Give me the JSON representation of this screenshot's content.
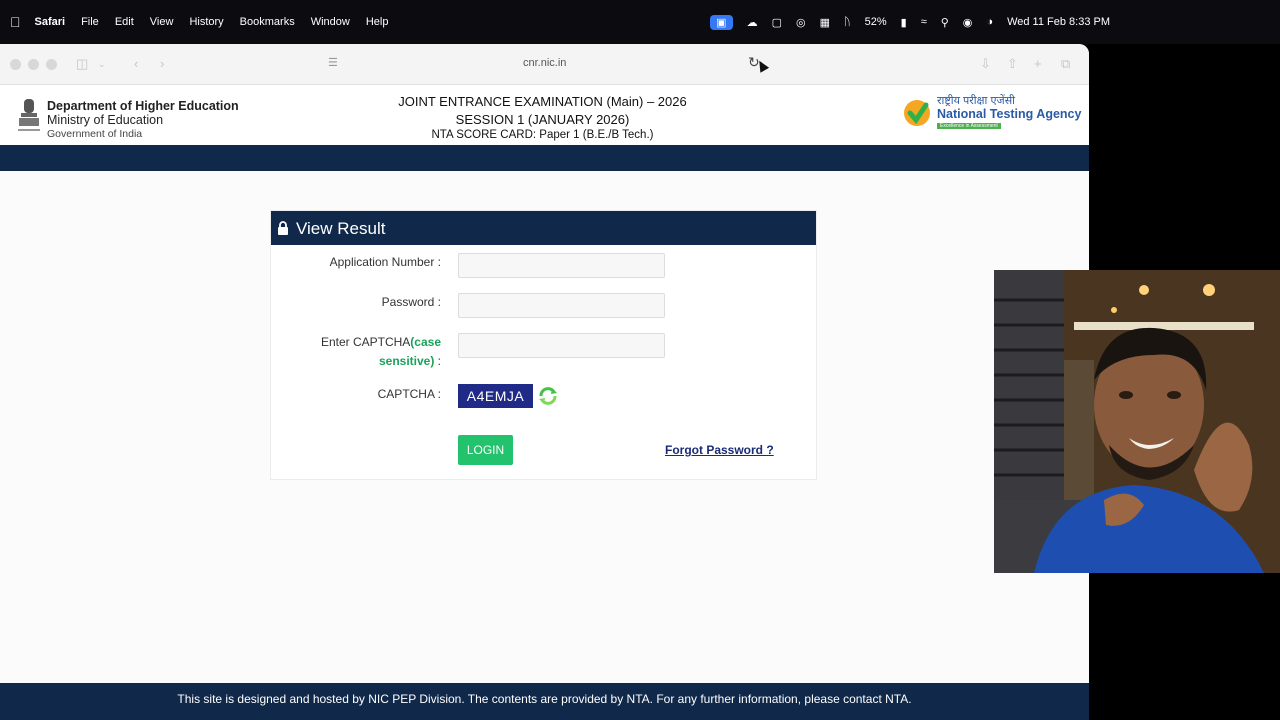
{
  "menubar": {
    "app": "Safari",
    "menus": [
      "File",
      "Edit",
      "View",
      "History",
      "Bookmarks",
      "Window",
      "Help"
    ],
    "battery": "52%",
    "datetime": "Wed 11 Feb  8:33 PM"
  },
  "browser": {
    "url": "cnr.nic.in"
  },
  "header": {
    "dept_line1": "Department of Higher Education",
    "dept_line2": "Ministry of Education",
    "dept_line3": "Government of India",
    "exam_line1": "JOINT ENTRANCE EXAMINATION (Main) – 2026",
    "exam_line2": "SESSION 1 (JANUARY 2026)",
    "exam_line3": "NTA SCORE CARD: Paper 1 (B.E./B Tech.)",
    "nta_hindi": "राष्ट्रीय परीक्षा एजेंसी",
    "nta_english": "National Testing Agency",
    "nta_tagline": "Excellence in Assessment"
  },
  "form": {
    "title": "View Result",
    "application_label": "Application Number :",
    "password_label": "Password :",
    "captcha_input_label_a": "Enter CAPTCHA",
    "captcha_input_label_b": "(case",
    "captcha_input_label_c": "sensitive)",
    "captcha_input_label_d": " :",
    "captcha_label": "CAPTCHA :",
    "captcha_value": "A4EMJA",
    "login_label": "LOGIN",
    "forgot_label": "Forgot Password ?"
  },
  "footer": {
    "text": "This site is designed and hosted by NIC PEP Division. The contents are provided by NTA. For any further information, please contact NTA."
  },
  "colors": {
    "navy": "#10294a",
    "green": "#22c36c",
    "captcha_bg": "#1f2b86"
  }
}
